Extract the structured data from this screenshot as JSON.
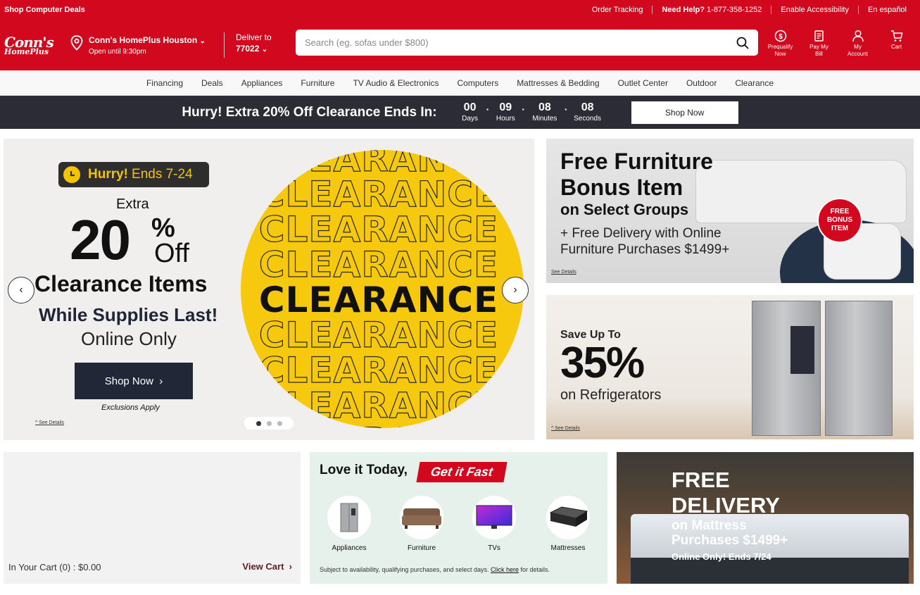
{
  "topbar": {
    "left_link": "Shop Computer Deals",
    "order_tracking": "Order Tracking",
    "need_help_label": "Need Help?",
    "phone": "1-877-358-1252",
    "accessibility": "Enable Accessibility",
    "language": "En español"
  },
  "header": {
    "logo_line1": "Conn's",
    "logo_line2": "HomePlus",
    "store_name": "Conn's HomePlus Houston",
    "store_hours": "Open until 9:30pm",
    "deliver_label": "Deliver to",
    "zip": "77022",
    "search_placeholder": "Search (eg. sofas under $800)",
    "icons": [
      {
        "name": "prequalify-icon",
        "label1": "Prequalify",
        "label2": "Now"
      },
      {
        "name": "pay-bill-icon",
        "label1": "Pay My",
        "label2": "Bill"
      },
      {
        "name": "account-icon",
        "label1": "My",
        "label2": "Account"
      },
      {
        "name": "cart-icon",
        "label1": "Cart",
        "label2": ""
      }
    ]
  },
  "nav": {
    "items": [
      "Financing",
      "Deals",
      "Appliances",
      "Furniture",
      "TV Audio & Electronics",
      "Computers",
      "Mattresses & Bedding",
      "Outlet Center",
      "Outdoor",
      "Clearance"
    ]
  },
  "promo": {
    "message": "Hurry! Extra 20% Off Clearance Ends In:",
    "countdown": [
      {
        "value": "00",
        "label": "Days"
      },
      {
        "value": "09",
        "label": "Hours"
      },
      {
        "value": "08",
        "label": "Minutes"
      },
      {
        "value": "08",
        "label": "Seconds"
      }
    ],
    "button": "Shop Now"
  },
  "hero": {
    "badge_bold": "Hurry!",
    "badge_rest": "Ends 7-24",
    "extra": "Extra",
    "big": "20",
    "pct": "%",
    "off": "Off",
    "title": "Clearance Items",
    "subtitle": "While Supplies Last!",
    "online": "Online Only",
    "button": "Shop Now",
    "exclusions": "Exclusions Apply",
    "see_details": "^ See Details",
    "circle_word": "CLEARANCE",
    "slide_count": 3,
    "active_slide": 1
  },
  "furniture_card": {
    "line1": "Free Furniture",
    "line2": "Bonus Item",
    "line3": "on Select Groups",
    "line4": "+ Free Delivery with Online",
    "line5": "Furniture Purchases $1499+",
    "badge1": "FREE",
    "badge2": "BONUS",
    "badge3": "ITEM",
    "see_details": "See Details"
  },
  "fridge_card": {
    "line1": "Save Up To",
    "line2": "35%",
    "line3": "on Refrigerators",
    "see_details": "^ See Details"
  },
  "cart": {
    "summary": "In Your Cart (0) : $0.00",
    "view": "View Cart"
  },
  "love": {
    "title": "Love it Today,",
    "get_fast": "Get it Fast",
    "categories": [
      "Appliances",
      "Furniture",
      "TVs",
      "Mattresses"
    ],
    "foot_text": "Subject to availability, qualifying purchases, and select days.",
    "foot_link": "Click here",
    "foot_end": "for details."
  },
  "mattress_card": {
    "line1": "FREE",
    "line2": "DELIVERY",
    "line3": "on Mattress",
    "line4": "Purchases $1499+",
    "line5": "Online Only! Ends 7/24"
  },
  "colors": {
    "brand_red": "#d2091e",
    "dark_bar": "#2b2c36",
    "clearance_yellow": "#f6c90e"
  }
}
